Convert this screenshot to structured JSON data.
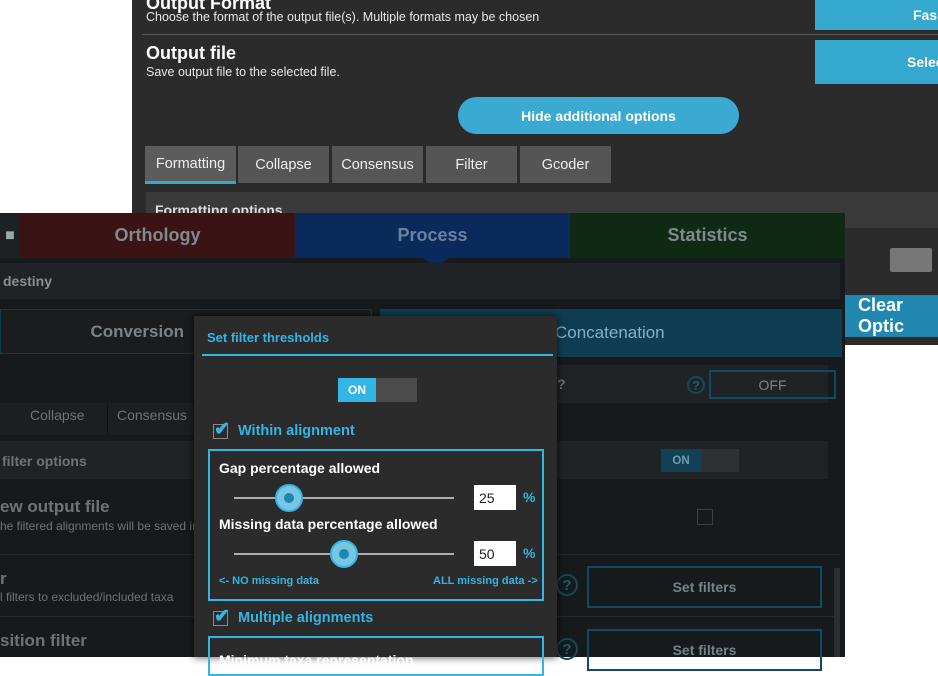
{
  "back": {
    "output_format_title": "Output Format",
    "output_format_desc": "Choose the format of the output file(s). Multiple formats may be chosen",
    "output_format_btn": "Fas",
    "output_file_title": "Output file",
    "output_file_desc": "Save output file to the selected file.",
    "output_file_btn": "Selec",
    "hide_btn": "Hide additional options",
    "tabs": [
      "Formatting",
      "Collapse",
      "Consensus",
      "Filter",
      "Gcoder"
    ],
    "formatting_options": "Formatting options",
    "clear_btn": "Clear Optic"
  },
  "front": {
    "headers": [
      "Orthology",
      "Process",
      "Statistics"
    ],
    "header_colors": {
      "orthology": "#3a1414",
      "process": "#0a2a5c",
      "statistics": "#0f2a14"
    },
    "destiny": "destiny",
    "conversion": "Conversion",
    "concatenation": "Concatenation",
    "q_text": "?",
    "off_label": "OFF",
    "tab_collapse": "Collapse",
    "tab_consensus": "Consensus",
    "filter_options": "filter options",
    "on_label": "ON",
    "new_output_title": "ew output file",
    "new_output_desc": "he filtered alignments will be saved in",
    "r_title": "r",
    "r_desc": "l filters to excluded/included taxa",
    "position_title": "sition filter",
    "set_filters_1": "Set filters",
    "set_filters_2": "Set filters"
  },
  "dialog": {
    "title": "Set filter thresholds",
    "toggle_on": "ON",
    "within_alignment": "Within alignment",
    "gap_label": "Gap percentage allowed",
    "gap_value": "25",
    "gap_fraction": 0.25,
    "missing_label": "Missing data percentage allowed",
    "missing_value": "50",
    "missing_fraction": 0.5,
    "pct": "%",
    "no_missing": "<- NO missing data",
    "all_missing": "ALL missing data ->",
    "multiple_alignments": "Multiple alignments",
    "min_taxa_partial": "Minimum taxa representation"
  }
}
